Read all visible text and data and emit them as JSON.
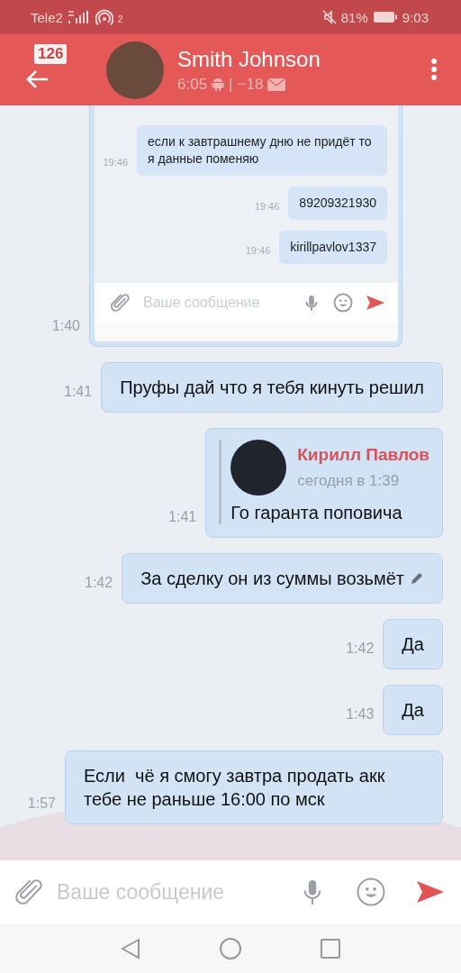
{
  "status_bar": {
    "carrier": "Tele2",
    "hotspot_count": "2",
    "battery": "81%",
    "time": "9:03"
  },
  "header": {
    "unread_count": "126",
    "name": "Smith Johnson",
    "last_seen": "6:05",
    "separator": "|",
    "distance": "~18"
  },
  "messages": [
    {
      "kind": "image",
      "time": "1:40",
      "image": {
        "messages": [
          {
            "text": "если к завтрашнему дню не придёт то я данные поменяю",
            "time": "19:46"
          },
          {
            "text": "89209321930",
            "time": "19:46"
          },
          {
            "text": "kirillpavlov1337",
            "time": "19:46"
          }
        ],
        "placeholder": "Ваше сообщение"
      }
    },
    {
      "kind": "text",
      "time": "1:41",
      "text": "Пруфы дай что я тебя кинуть решил",
      "edited": false
    },
    {
      "kind": "reply",
      "time": "1:41",
      "reply": {
        "author": "Кирилл Павлов",
        "date": "сегодня в 1:39"
      },
      "text": "Го гаранта поповича"
    },
    {
      "kind": "text",
      "time": "1:42",
      "text": "За сделку он из суммы возьмёт",
      "edited": true
    },
    {
      "kind": "text",
      "time": "1:42",
      "text": "Да",
      "edited": false
    },
    {
      "kind": "text",
      "time": "1:43",
      "text": "Да",
      "edited": false
    },
    {
      "kind": "text",
      "time": "1:57",
      "text": "Если  чё я смогу завтра продать акк тебе не раньше 16:00 по мск",
      "edited": false
    }
  ],
  "composer": {
    "placeholder": "Ваше сообщение"
  }
}
